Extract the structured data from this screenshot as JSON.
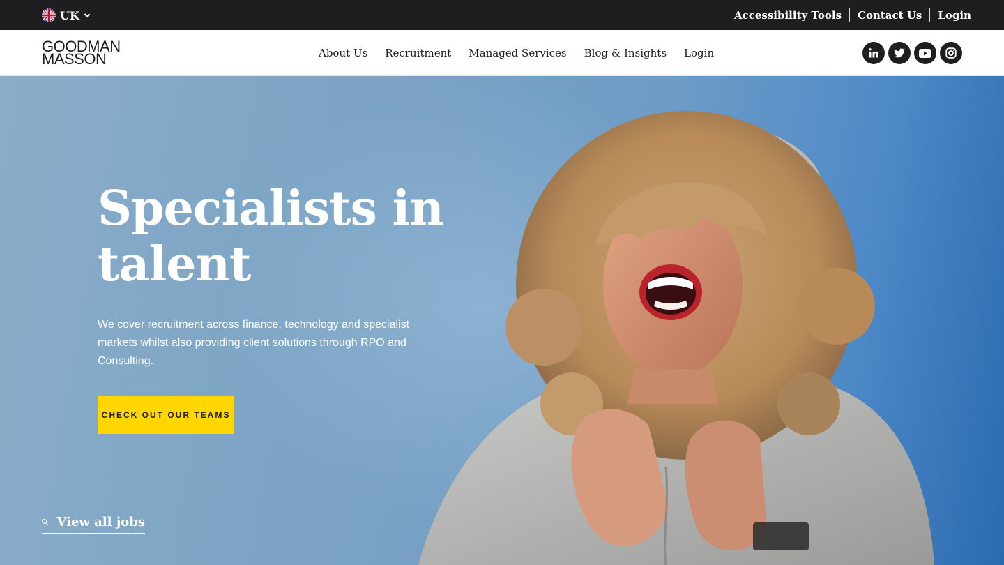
{
  "topbar": {
    "region": {
      "label": "UK",
      "flag_icon": "uk-flag-icon"
    },
    "links": [
      "Accessibility Tools",
      "Contact Us",
      "Login"
    ]
  },
  "header": {
    "logo": {
      "line1": "GOODMAN",
      "line2": "MASSON"
    },
    "nav": [
      "About Us",
      "Recruitment",
      "Managed Services",
      "Blog & Insights",
      "Login"
    ],
    "socials": [
      "linkedin-icon",
      "twitter-icon",
      "youtube-icon",
      "instagram-icon"
    ]
  },
  "hero": {
    "title": "Specialists in talent",
    "description": "We cover recruitment across finance, technology and specialist markets whilst also providing client solutions through RPO and Consulting.",
    "cta_label": "CHECK OUT OUR TEAMS",
    "view_jobs_label": "View all jobs"
  },
  "colors": {
    "topbar_bg": "#1e1e20",
    "hero_blue": "#6d9cc6",
    "cta_yellow": "#ffd600"
  }
}
